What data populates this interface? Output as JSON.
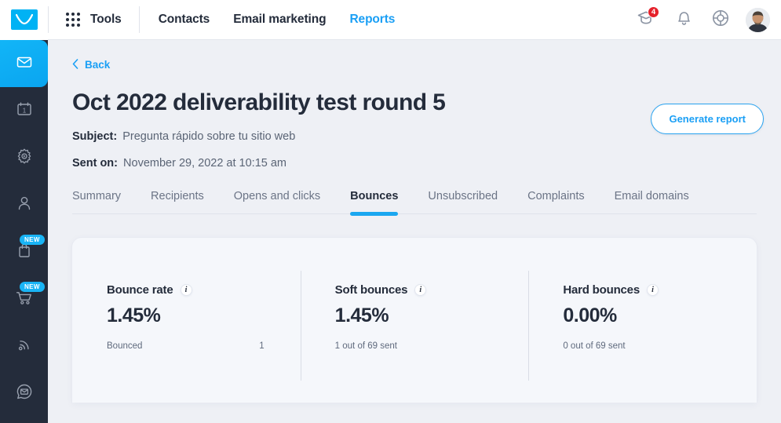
{
  "header": {
    "logo_icon": "envelope-logo-icon",
    "tools": {
      "label": "Tools",
      "icon": "grid-dots-icon"
    },
    "nav": [
      {
        "label": "Contacts",
        "active": false
      },
      {
        "label": "Email marketing",
        "active": false
      },
      {
        "label": "Reports",
        "active": true
      }
    ],
    "actions": [
      {
        "icon": "graduation-cap-icon",
        "badge": "4"
      },
      {
        "icon": "bell-icon",
        "badge": ""
      },
      {
        "icon": "lifebuoy-help-icon",
        "badge": ""
      }
    ],
    "avatar": {
      "icon": "user-avatar"
    },
    "accent_color": "#1a9ff5",
    "badge_color": "#e5212b"
  },
  "sidebar": {
    "background_color": "#242c3b",
    "active_color": "#0aa5f0",
    "items": [
      {
        "icon": "envelope-icon",
        "active": true,
        "badge": ""
      },
      {
        "icon": "calendar-icon",
        "active": false,
        "badge": ""
      },
      {
        "icon": "gear-settings-icon",
        "active": false,
        "badge": ""
      },
      {
        "icon": "person-icon",
        "active": false,
        "badge": ""
      },
      {
        "icon": "shopping-bag-icon",
        "active": false,
        "badge": "NEW"
      },
      {
        "icon": "shopping-cart-icon",
        "active": false,
        "badge": "NEW"
      },
      {
        "icon": "rss-signal-icon",
        "active": false,
        "badge": ""
      },
      {
        "icon": "chat-envelope-icon",
        "active": false,
        "badge": ""
      }
    ]
  },
  "page": {
    "back_label": "Back",
    "back_icon": "chevron-left-icon",
    "generate_report_label": "Generate report",
    "title": "Oct 2022 deliverability test round 5",
    "subject_label": "Subject:",
    "subject_value": "Pregunta rápido sobre tu sitio web",
    "sent_on_label": "Sent on:",
    "sent_on_value": "November 29, 2022 at 10:15 am"
  },
  "tabs": [
    {
      "label": "Summary",
      "active": false
    },
    {
      "label": "Recipients",
      "active": false
    },
    {
      "label": "Opens and clicks",
      "active": false
    },
    {
      "label": "Bounces",
      "active": true
    },
    {
      "label": "Unsubscribed",
      "active": false
    },
    {
      "label": "Complaints",
      "active": false
    },
    {
      "label": "Email domains",
      "active": false
    }
  ],
  "stats": [
    {
      "title": "Bounce rate",
      "info_icon": "info-icon",
      "value": "1.45%",
      "foot_label": "Bounced",
      "foot_value": "1"
    },
    {
      "title": "Soft bounces",
      "info_icon": "info-icon",
      "value": "1.45%",
      "foot_label": "1 out of 69 sent",
      "foot_value": ""
    },
    {
      "title": "Hard bounces",
      "info_icon": "info-icon",
      "value": "0.00%",
      "foot_label": "0 out of 69 sent",
      "foot_value": ""
    }
  ]
}
